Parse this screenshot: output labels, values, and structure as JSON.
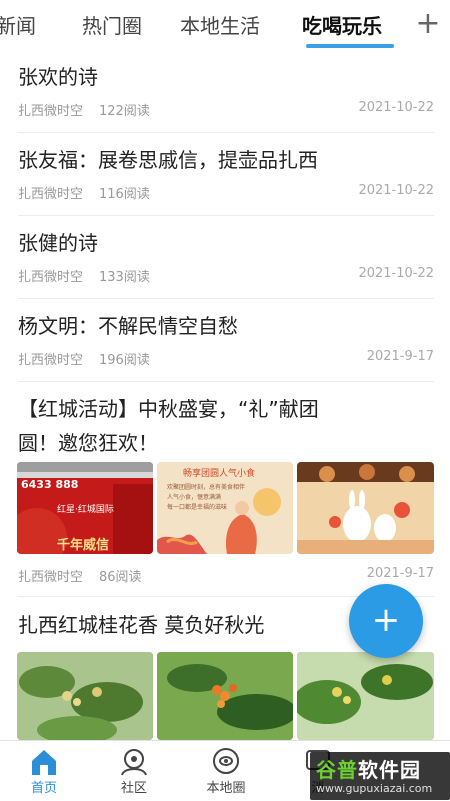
{
  "tabs": {
    "items": [
      "新闻",
      "热门圈",
      "本地生活",
      "吃喝玩乐"
    ],
    "active": "吃喝玩乐",
    "add_label": "+"
  },
  "articles": [
    {
      "title": "张欢的诗",
      "source": "扎西微时空",
      "reads": "122阅读",
      "date": "2021-10-22"
    },
    {
      "title": "张友福：展卷思戚信，提壶品扎西",
      "source": "扎西微时空",
      "reads": "116阅读",
      "date": "2021-10-22"
    },
    {
      "title": "张健的诗",
      "source": "扎西微时空",
      "reads": "133阅读",
      "date": "2021-10-22"
    },
    {
      "title": "杨文明：不解民情空自愁",
      "source": "扎西微时空",
      "reads": "196阅读",
      "date": "2021-9-17"
    },
    {
      "title_line1": "【红城活动】中秋盛宴，“礼”献团",
      "title_line2": "圆！邀您狂欢！",
      "source": "扎西微时空",
      "reads": "86阅读",
      "date": "2021-9-17",
      "images": [
        {
          "text_phone": "6433 888",
          "text_brand": "红星·红城国际",
          "text_slogan": "千年威信"
        },
        {
          "text_heading": "畅享团圆人气小食",
          "text_body1": "欢聚团圆时刻，总有美食相伴",
          "text_body2": "人气小食，惬意满满",
          "text_body3": "每一口都是幸福的滋味"
        },
        {}
      ]
    },
    {
      "title": "扎西红城桂花香  莫负好秋光"
    }
  ],
  "fab": {
    "label": "+"
  },
  "bottom_nav": [
    {
      "label": "首页",
      "icon": "home-icon",
      "active": true
    },
    {
      "label": "社区",
      "icon": "community-icon",
      "active": false
    },
    {
      "label": "本地圈",
      "icon": "local-circle-icon",
      "active": false
    },
    {
      "label": "消",
      "icon": "message-icon",
      "active": false
    }
  ],
  "watermark": {
    "main_a": "谷普",
    "main_b": "软件园",
    "sub": "www.gupuxiazai.com"
  },
  "colors": {
    "accent": "#2b9be6",
    "tab_underline": "#3aa0e6",
    "meta": "#999999"
  }
}
